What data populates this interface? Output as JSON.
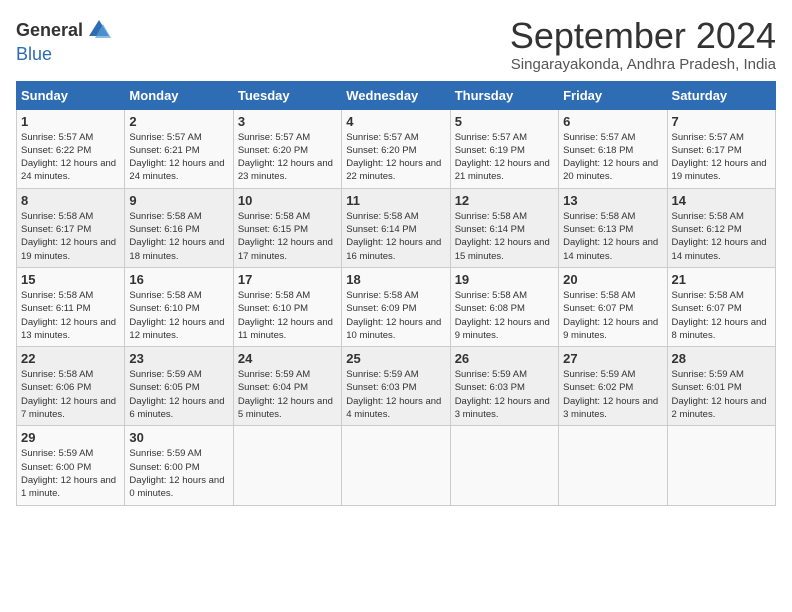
{
  "header": {
    "logo_general": "General",
    "logo_blue": "Blue",
    "month_title": "September 2024",
    "location": "Singarayakonda, Andhra Pradesh, India"
  },
  "days_of_week": [
    "Sunday",
    "Monday",
    "Tuesday",
    "Wednesday",
    "Thursday",
    "Friday",
    "Saturday"
  ],
  "weeks": [
    [
      {
        "day": "1",
        "sunrise": "Sunrise: 5:57 AM",
        "sunset": "Sunset: 6:22 PM",
        "daylight": "Daylight: 12 hours and 24 minutes."
      },
      {
        "day": "2",
        "sunrise": "Sunrise: 5:57 AM",
        "sunset": "Sunset: 6:21 PM",
        "daylight": "Daylight: 12 hours and 24 minutes."
      },
      {
        "day": "3",
        "sunrise": "Sunrise: 5:57 AM",
        "sunset": "Sunset: 6:20 PM",
        "daylight": "Daylight: 12 hours and 23 minutes."
      },
      {
        "day": "4",
        "sunrise": "Sunrise: 5:57 AM",
        "sunset": "Sunset: 6:20 PM",
        "daylight": "Daylight: 12 hours and 22 minutes."
      },
      {
        "day": "5",
        "sunrise": "Sunrise: 5:57 AM",
        "sunset": "Sunset: 6:19 PM",
        "daylight": "Daylight: 12 hours and 21 minutes."
      },
      {
        "day": "6",
        "sunrise": "Sunrise: 5:57 AM",
        "sunset": "Sunset: 6:18 PM",
        "daylight": "Daylight: 12 hours and 20 minutes."
      },
      {
        "day": "7",
        "sunrise": "Sunrise: 5:57 AM",
        "sunset": "Sunset: 6:17 PM",
        "daylight": "Daylight: 12 hours and 19 minutes."
      }
    ],
    [
      {
        "day": "8",
        "sunrise": "Sunrise: 5:58 AM",
        "sunset": "Sunset: 6:17 PM",
        "daylight": "Daylight: 12 hours and 19 minutes."
      },
      {
        "day": "9",
        "sunrise": "Sunrise: 5:58 AM",
        "sunset": "Sunset: 6:16 PM",
        "daylight": "Daylight: 12 hours and 18 minutes."
      },
      {
        "day": "10",
        "sunrise": "Sunrise: 5:58 AM",
        "sunset": "Sunset: 6:15 PM",
        "daylight": "Daylight: 12 hours and 17 minutes."
      },
      {
        "day": "11",
        "sunrise": "Sunrise: 5:58 AM",
        "sunset": "Sunset: 6:14 PM",
        "daylight": "Daylight: 12 hours and 16 minutes."
      },
      {
        "day": "12",
        "sunrise": "Sunrise: 5:58 AM",
        "sunset": "Sunset: 6:14 PM",
        "daylight": "Daylight: 12 hours and 15 minutes."
      },
      {
        "day": "13",
        "sunrise": "Sunrise: 5:58 AM",
        "sunset": "Sunset: 6:13 PM",
        "daylight": "Daylight: 12 hours and 14 minutes."
      },
      {
        "day": "14",
        "sunrise": "Sunrise: 5:58 AM",
        "sunset": "Sunset: 6:12 PM",
        "daylight": "Daylight: 12 hours and 14 minutes."
      }
    ],
    [
      {
        "day": "15",
        "sunrise": "Sunrise: 5:58 AM",
        "sunset": "Sunset: 6:11 PM",
        "daylight": "Daylight: 12 hours and 13 minutes."
      },
      {
        "day": "16",
        "sunrise": "Sunrise: 5:58 AM",
        "sunset": "Sunset: 6:10 PM",
        "daylight": "Daylight: 12 hours and 12 minutes."
      },
      {
        "day": "17",
        "sunrise": "Sunrise: 5:58 AM",
        "sunset": "Sunset: 6:10 PM",
        "daylight": "Daylight: 12 hours and 11 minutes."
      },
      {
        "day": "18",
        "sunrise": "Sunrise: 5:58 AM",
        "sunset": "Sunset: 6:09 PM",
        "daylight": "Daylight: 12 hours and 10 minutes."
      },
      {
        "day": "19",
        "sunrise": "Sunrise: 5:58 AM",
        "sunset": "Sunset: 6:08 PM",
        "daylight": "Daylight: 12 hours and 9 minutes."
      },
      {
        "day": "20",
        "sunrise": "Sunrise: 5:58 AM",
        "sunset": "Sunset: 6:07 PM",
        "daylight": "Daylight: 12 hours and 9 minutes."
      },
      {
        "day": "21",
        "sunrise": "Sunrise: 5:58 AM",
        "sunset": "Sunset: 6:07 PM",
        "daylight": "Daylight: 12 hours and 8 minutes."
      }
    ],
    [
      {
        "day": "22",
        "sunrise": "Sunrise: 5:58 AM",
        "sunset": "Sunset: 6:06 PM",
        "daylight": "Daylight: 12 hours and 7 minutes."
      },
      {
        "day": "23",
        "sunrise": "Sunrise: 5:59 AM",
        "sunset": "Sunset: 6:05 PM",
        "daylight": "Daylight: 12 hours and 6 minutes."
      },
      {
        "day": "24",
        "sunrise": "Sunrise: 5:59 AM",
        "sunset": "Sunset: 6:04 PM",
        "daylight": "Daylight: 12 hours and 5 minutes."
      },
      {
        "day": "25",
        "sunrise": "Sunrise: 5:59 AM",
        "sunset": "Sunset: 6:03 PM",
        "daylight": "Daylight: 12 hours and 4 minutes."
      },
      {
        "day": "26",
        "sunrise": "Sunrise: 5:59 AM",
        "sunset": "Sunset: 6:03 PM",
        "daylight": "Daylight: 12 hours and 3 minutes."
      },
      {
        "day": "27",
        "sunrise": "Sunrise: 5:59 AM",
        "sunset": "Sunset: 6:02 PM",
        "daylight": "Daylight: 12 hours and 3 minutes."
      },
      {
        "day": "28",
        "sunrise": "Sunrise: 5:59 AM",
        "sunset": "Sunset: 6:01 PM",
        "daylight": "Daylight: 12 hours and 2 minutes."
      }
    ],
    [
      {
        "day": "29",
        "sunrise": "Sunrise: 5:59 AM",
        "sunset": "Sunset: 6:00 PM",
        "daylight": "Daylight: 12 hours and 1 minute."
      },
      {
        "day": "30",
        "sunrise": "Sunrise: 5:59 AM",
        "sunset": "Sunset: 6:00 PM",
        "daylight": "Daylight: 12 hours and 0 minutes."
      },
      null,
      null,
      null,
      null,
      null
    ]
  ]
}
